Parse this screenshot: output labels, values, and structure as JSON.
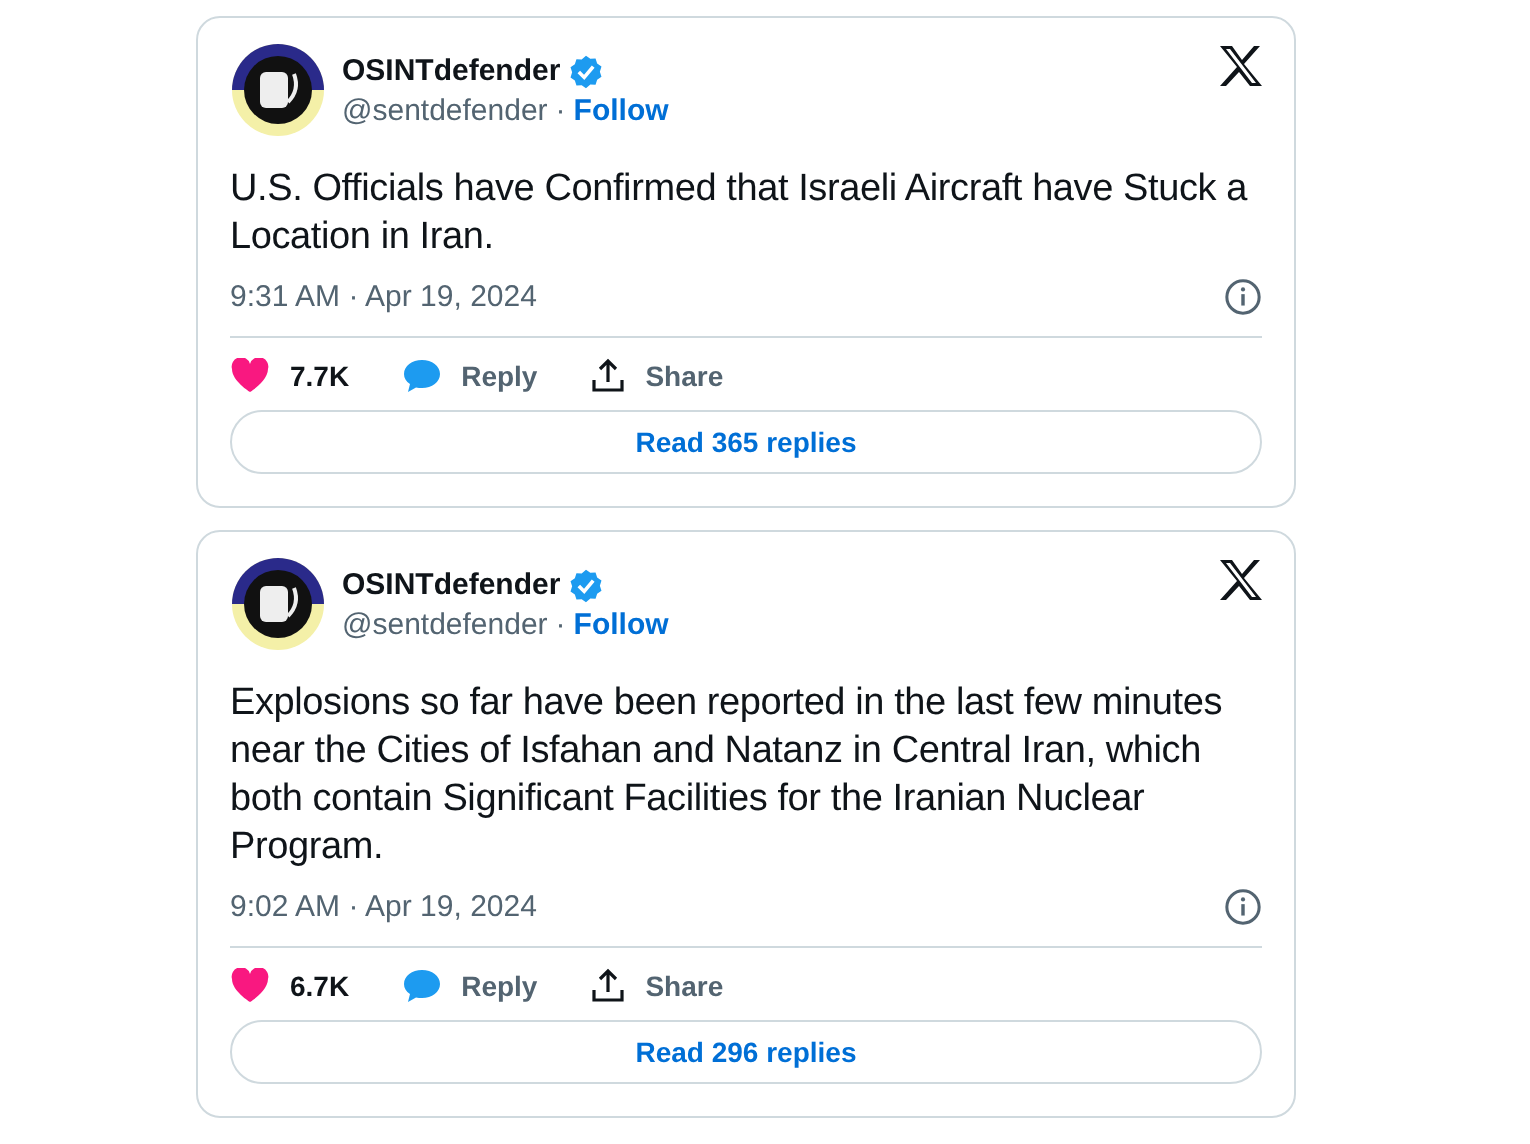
{
  "tweets": [
    {
      "name": "OSINTdefender",
      "handle": "@sentdefender",
      "separator": "·",
      "follow": "Follow",
      "text": "U.S. Officials have Confirmed that Israeli Aircraft have Stuck a Location in Iran.",
      "time": "9:31 AM · Apr 19, 2024",
      "likes": "7.7K",
      "reply": "Reply",
      "share": "Share",
      "read_replies": "Read 365 replies"
    },
    {
      "name": "OSINTdefender",
      "handle": "@sentdefender",
      "separator": "·",
      "follow": "Follow",
      "text": "Explosions so far have been reported in the last few minutes near the Cities of Isfahan and Natanz in Central Iran, which both contain Significant Facilities for the Iranian Nuclear Program.",
      "time": "9:02 AM · Apr 19, 2024",
      "likes": "6.7K",
      "reply": "Reply",
      "share": "Share",
      "read_replies": "Read 296 replies"
    }
  ]
}
